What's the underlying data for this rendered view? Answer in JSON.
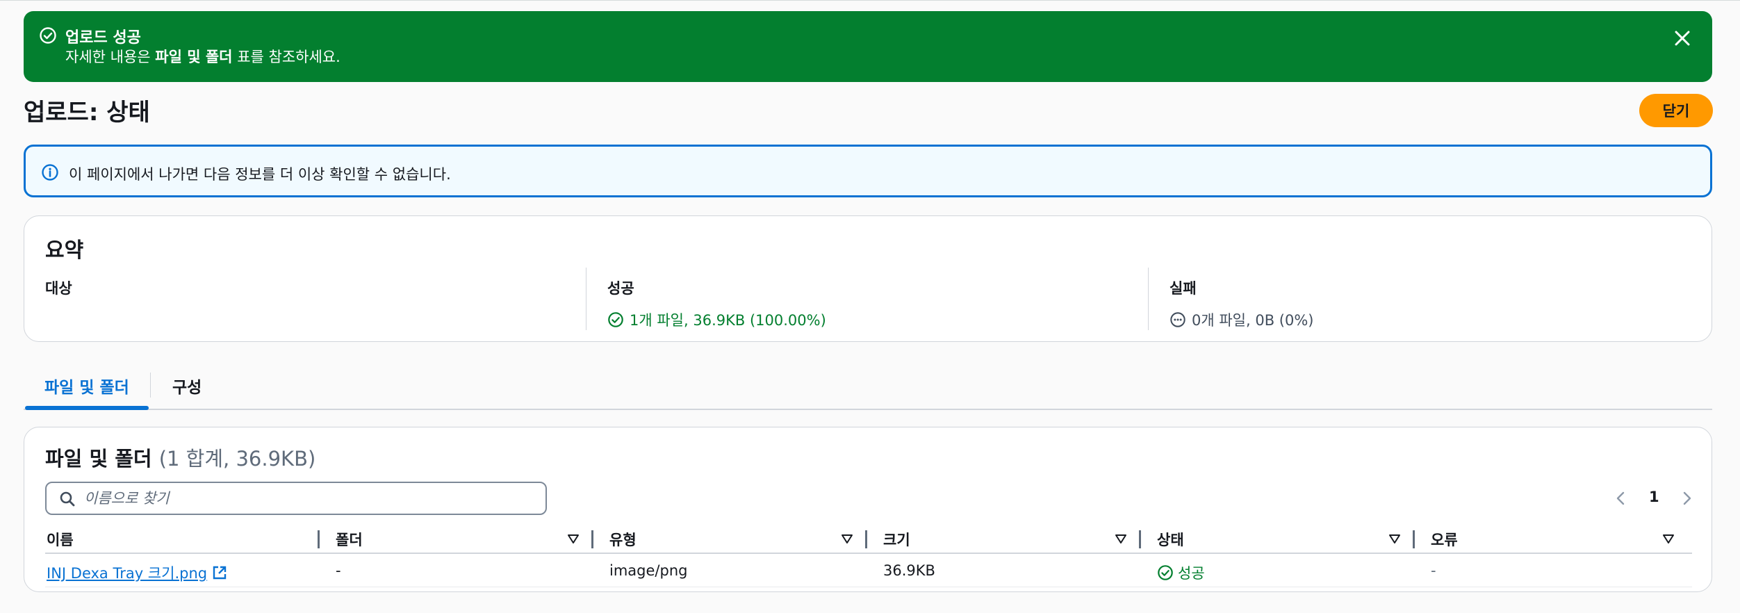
{
  "flash": {
    "title": "업로드 성공",
    "message_prefix": "자세한 내용은 ",
    "message_bold": "파일 및 폴더",
    "message_suffix": " 표를 참조하세요."
  },
  "header": {
    "title": "업로드: 상태",
    "close_label": "닫기"
  },
  "info": {
    "text": "이 페이지에서 나가면 다음 정보를 더 이상 확인할 수 없습니다."
  },
  "summary": {
    "title": "요약",
    "target_label": "대상",
    "target_value": "",
    "success_label": "성공",
    "success_value": "1개 파일, 36.9KB (100.00%)",
    "failure_label": "실패",
    "failure_value": "0개 파일, 0B (0%)"
  },
  "tabs": [
    {
      "label": "파일 및 폴더",
      "active": true
    },
    {
      "label": "구성",
      "active": false
    }
  ],
  "files": {
    "title": "파일 및 폴더",
    "count": "(1 합계, 36.9KB)",
    "search_placeholder": "이름으로 찾기",
    "page": "1",
    "columns": [
      "이름",
      "폴더",
      "유형",
      "크기",
      "상태",
      "오류"
    ],
    "rows": [
      {
        "name": "INJ Dexa Tray 크기.png",
        "folder": "-",
        "type": "image/png",
        "size": "36.9KB",
        "status": "성공",
        "error": "-"
      }
    ]
  },
  "colors": {
    "success": "#037f2f",
    "info": "#0972d3",
    "primary_button": "#ff9900"
  }
}
